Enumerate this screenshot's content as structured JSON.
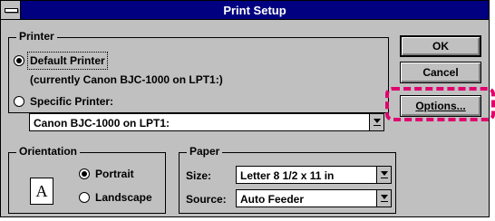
{
  "window": {
    "title": "Print Setup"
  },
  "printer_group": {
    "label": "Printer",
    "default_option": "Default Printer",
    "default_detail": "(currently Canon BJC-1000 on LPT1:)",
    "specific_option": "Specific Printer:",
    "specific_value": "Canon BJC-1000 on LPT1:"
  },
  "orientation_group": {
    "label": "Orientation",
    "icon_letter": "A",
    "portrait": "Portrait",
    "landscape": "Landscape"
  },
  "paper_group": {
    "label": "Paper",
    "size_label": "Size:",
    "size_value": "Letter 8 1/2 x 11 in",
    "source_label": "Source:",
    "source_value": "Auto Feeder"
  },
  "buttons": {
    "ok": "OK",
    "cancel": "Cancel",
    "options": "Options..."
  },
  "highlight_color": "#e0006e"
}
